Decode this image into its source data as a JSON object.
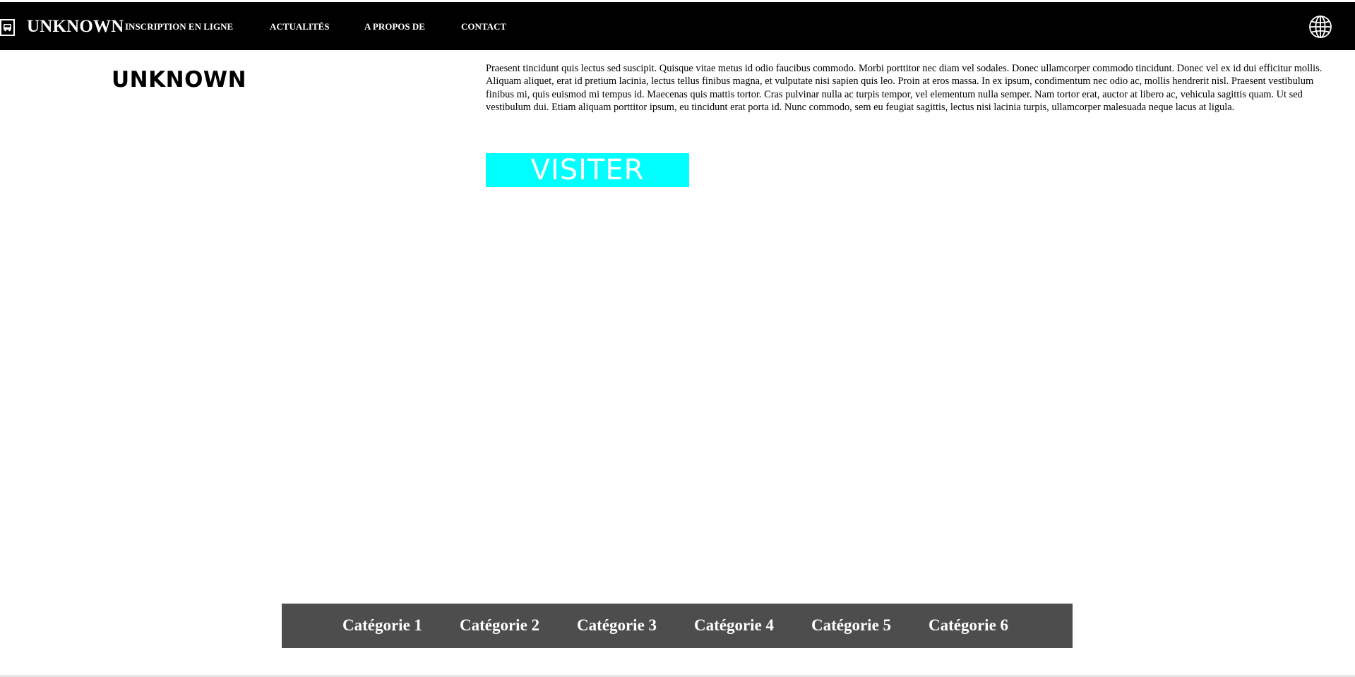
{
  "header": {
    "brand": "UNKNOWN",
    "nav": [
      {
        "label": "INSCRIPTION EN LIGNE"
      },
      {
        "label": "ACTUALITÉS"
      },
      {
        "label": "A PROPOS DE"
      },
      {
        "label": "CONTACT"
      }
    ],
    "logo_icon": "bus-icon",
    "language_icon": "globe-icon"
  },
  "main": {
    "side_title": "UNKNOWN",
    "paragraph": "Praesent tincidunt quis lectus sed suscipit. Quisque vitae metus id odio faucibus commodo. Morbi porttitor nec diam vel sodales. Donec ullamcorper commodo tincidunt. Donec vel ex id dui efficitur mollis. Aliquam aliquet, erat id pretium lacinia, lectus tellus finibus magna, et vulputate nisi sapien quis leo. Proin at eros massa. In ex ipsum, condimentum nec odio ac, mollis hendrerit nisl. Praesent vestibulum finibus mi, quis euismod mi tempus id. Maecenas quis mattis tortor. Cras pulvinar nulla ac turpis tempor, vel elementum nulla semper. Nam tortor erat, auctor at libero ac, vehicula sagittis quam. Ut sed vestibulum dui. Etiam aliquam porttitor ipsum, eu tincidunt erat porta id. Nunc commodo, sem eu feugiat sagittis, lectus nisi lacinia turpis, ullamcorper malesuada neque lacus at ligula.",
    "visit_button": "VISITER"
  },
  "categories": [
    {
      "label": "Catégorie 1"
    },
    {
      "label": "Catégorie 2"
    },
    {
      "label": "Catégorie 3"
    },
    {
      "label": "Catégorie 4"
    },
    {
      "label": "Catégorie 5"
    },
    {
      "label": "Catégorie 6"
    }
  ],
  "colors": {
    "header_bg": "#000000",
    "button_bg": "#00ffff",
    "category_bar_bg": "#4d4d4d"
  }
}
